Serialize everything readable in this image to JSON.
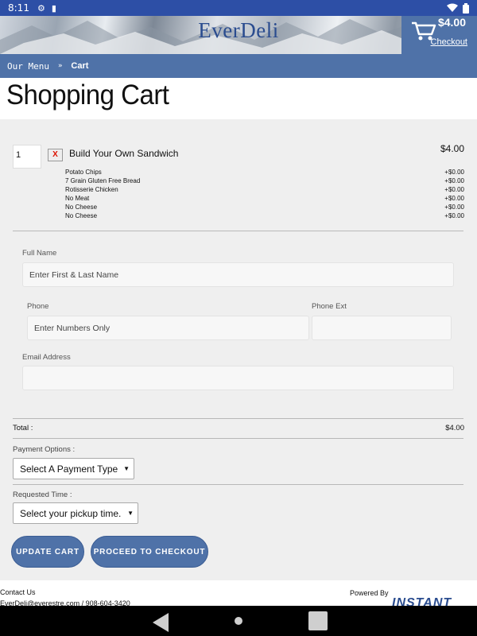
{
  "status_bar": {
    "time": "8:11"
  },
  "header": {
    "logo": "EverDeli",
    "cart_total": "$4.00",
    "checkout_link": "Checkout"
  },
  "breadcrumb": {
    "items": [
      "Our Menu",
      "Cart"
    ],
    "separator": "»"
  },
  "page_title": "Shopping Cart",
  "cart": {
    "items": [
      {
        "quantity": "1",
        "remove_label": "X",
        "name": "Build Your Own Sandwich",
        "price": "$4.00",
        "options": [
          {
            "name": "Potato Chips",
            "price": "+$0.00"
          },
          {
            "name": "7 Grain Gluten Free Bread",
            "price": "+$0.00"
          },
          {
            "name": "Rotisserie Chicken",
            "price": "+$0.00"
          },
          {
            "name": "No Meat",
            "price": "+$0.00"
          },
          {
            "name": "No Cheese",
            "price": "+$0.00"
          },
          {
            "name": "No Cheese",
            "price": "+$0.00"
          }
        ]
      }
    ]
  },
  "form": {
    "full_name_label": "Full Name",
    "full_name_placeholder": "Enter First & Last Name",
    "phone_label": "Phone",
    "phone_placeholder": "Enter Numbers Only",
    "phone_ext_label": "Phone Ext",
    "email_label": "Email Address"
  },
  "total": {
    "label": "Total :",
    "value": "$4.00"
  },
  "payment": {
    "label": "Payment Options :",
    "selected": "Select A Payment Type"
  },
  "requested_time": {
    "label": "Requested Time :",
    "selected": "Select your pickup time."
  },
  "buttons": {
    "update_cart": "UPDATE CART",
    "proceed": "PROCEED TO CHECKOUT"
  },
  "footer": {
    "contact": "Contact Us",
    "email_phone": "EverDeli@everestre.com / 908-604-3420",
    "powered_by": "Powered By",
    "logo": "INSTANT"
  },
  "colors": {
    "accent": "#4f72a8",
    "status_bar": "#2d4fa6",
    "panel": "#efefef"
  }
}
